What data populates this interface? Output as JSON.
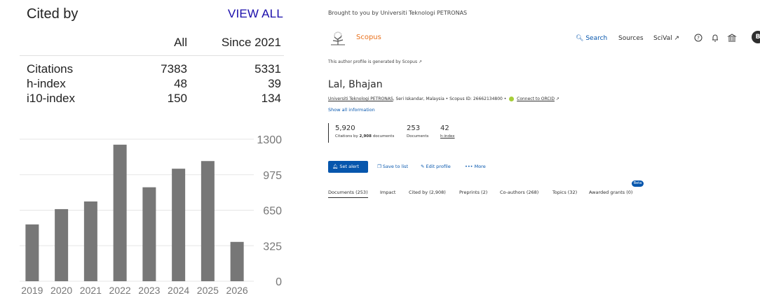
{
  "scholar": {
    "title": "Cited by",
    "view_all": "VIEW ALL",
    "columns": [
      "All",
      "Since 2021"
    ],
    "rows": [
      {
        "label": "Citations",
        "all": "7383",
        "since": "5331"
      },
      {
        "label": "h-index",
        "all": "48",
        "since": "39"
      },
      {
        "label": "i10-index",
        "all": "150",
        "since": "134"
      }
    ]
  },
  "chart_data": {
    "type": "bar",
    "categories": [
      "2019",
      "2020",
      "2021",
      "2022",
      "2023",
      "2024",
      "2025",
      "2026"
    ],
    "values": [
      520,
      660,
      730,
      1250,
      860,
      1030,
      1100,
      360
    ],
    "ylim": [
      0,
      1300
    ],
    "yticks": [
      "0",
      "325",
      "650",
      "975",
      "1300"
    ],
    "y_axis_side": "right",
    "grid": true,
    "bar_color": "#777777"
  },
  "scopus": {
    "brought_by": "Brought to you by Universiti Teknologi PETRONAS",
    "brand": "Scopus",
    "nav": {
      "search": "Search",
      "sources": "Sources",
      "scival": "SciVal ↗"
    },
    "avatar_initial": "B",
    "profile_note": "This author profile is generated by Scopus ↗",
    "author_name": "Lal, Bhajan",
    "affiliation_link": "Universiti Teknologi PETRONAS",
    "affiliation_rest": ", Seri Iskandar, Malaysia • Scopus ID: 26662134800 •",
    "orcid_link": "Connect to ORCID",
    "orcid_arrow": "↗",
    "show_all": "Show all information",
    "metrics": {
      "citations": "5,920",
      "citations_label_pre": "Citations by ",
      "citations_label_bold": "2,908",
      "citations_label_post": " documents",
      "documents": "253",
      "documents_label": "Documents",
      "hindex": "42",
      "hindex_label": "h-index"
    },
    "actions": {
      "set_alert": "Set alert",
      "save_to_list": "Save to list",
      "edit_profile": "Edit profile",
      "more": "More"
    },
    "tabs": [
      "Documents (253)",
      "Impact",
      "Cited by (2,908)",
      "Preprints (2)",
      "Co-authors (268)",
      "Topics (32)",
      "Awarded grants (0)"
    ],
    "beta": "Beta",
    "colors": {
      "accent": "#0656ad",
      "brand_orange": "#e9711c",
      "orcid_green": "#a6ce39"
    }
  }
}
